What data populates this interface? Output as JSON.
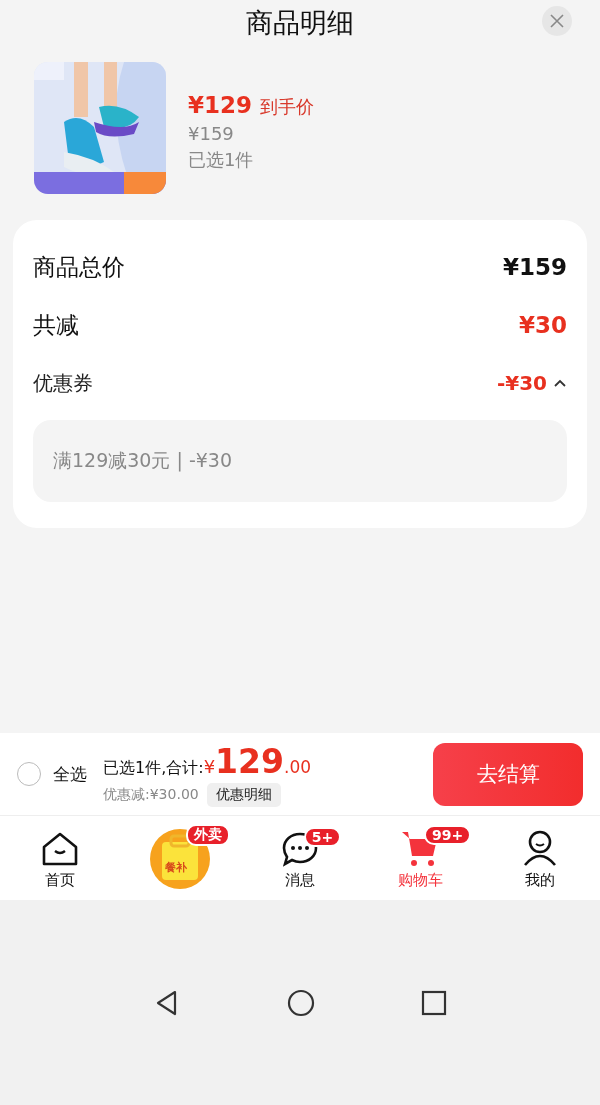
{
  "header": {
    "title": "商品明细"
  },
  "product": {
    "price": "¥129",
    "price_label": "到手价",
    "original_price": "¥159",
    "selected_count": "已选1件"
  },
  "summary": {
    "rows": [
      {
        "label": "商品总价",
        "value": "¥159",
        "kind": "total"
      },
      {
        "label": "共减",
        "value": "¥30",
        "kind": "discount"
      },
      {
        "label": "优惠券",
        "value": "-¥30",
        "kind": "coupon",
        "expanded": true
      }
    ],
    "coupon_detail": "满129减30元 | -¥30"
  },
  "checkout": {
    "select_all": {
      "label": "全选",
      "checked": false
    },
    "summary_prefix": "已选1件,合计:",
    "currency": "¥",
    "amount_int": "129",
    "amount_dec": ".00",
    "discount": "优惠减:¥30.00",
    "detail_button": "优惠明细",
    "submit": "去结算"
  },
  "tabbar": [
    {
      "label": "首页",
      "kind": "home",
      "selected": false
    },
    {
      "kind": "promo",
      "badge": "外卖",
      "icon_text": "餐补"
    },
    {
      "label": "消息",
      "kind": "message",
      "badge": "5+",
      "selected": false
    },
    {
      "label": "购物车",
      "kind": "cart",
      "badge": "99+",
      "selected": true
    },
    {
      "label": "我的",
      "kind": "profile",
      "selected": false
    }
  ]
}
